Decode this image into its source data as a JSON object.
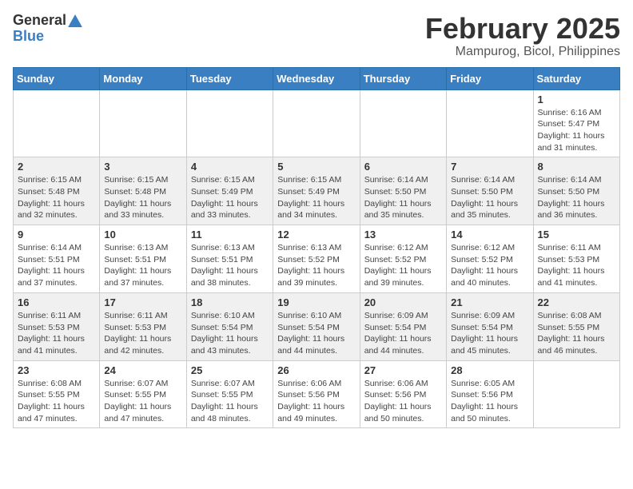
{
  "logo": {
    "general": "General",
    "blue": "Blue"
  },
  "title": {
    "month_year": "February 2025",
    "location": "Mampurog, Bicol, Philippines"
  },
  "weekdays": [
    "Sunday",
    "Monday",
    "Tuesday",
    "Wednesday",
    "Thursday",
    "Friday",
    "Saturday"
  ],
  "weeks": [
    [
      {
        "day": "",
        "info": ""
      },
      {
        "day": "",
        "info": ""
      },
      {
        "day": "",
        "info": ""
      },
      {
        "day": "",
        "info": ""
      },
      {
        "day": "",
        "info": ""
      },
      {
        "day": "",
        "info": ""
      },
      {
        "day": "1",
        "info": "Sunrise: 6:16 AM\nSunset: 5:47 PM\nDaylight: 11 hours and 31 minutes."
      }
    ],
    [
      {
        "day": "2",
        "info": "Sunrise: 6:15 AM\nSunset: 5:48 PM\nDaylight: 11 hours and 32 minutes."
      },
      {
        "day": "3",
        "info": "Sunrise: 6:15 AM\nSunset: 5:48 PM\nDaylight: 11 hours and 33 minutes."
      },
      {
        "day": "4",
        "info": "Sunrise: 6:15 AM\nSunset: 5:49 PM\nDaylight: 11 hours and 33 minutes."
      },
      {
        "day": "5",
        "info": "Sunrise: 6:15 AM\nSunset: 5:49 PM\nDaylight: 11 hours and 34 minutes."
      },
      {
        "day": "6",
        "info": "Sunrise: 6:14 AM\nSunset: 5:50 PM\nDaylight: 11 hours and 35 minutes."
      },
      {
        "day": "7",
        "info": "Sunrise: 6:14 AM\nSunset: 5:50 PM\nDaylight: 11 hours and 35 minutes."
      },
      {
        "day": "8",
        "info": "Sunrise: 6:14 AM\nSunset: 5:50 PM\nDaylight: 11 hours and 36 minutes."
      }
    ],
    [
      {
        "day": "9",
        "info": "Sunrise: 6:14 AM\nSunset: 5:51 PM\nDaylight: 11 hours and 37 minutes."
      },
      {
        "day": "10",
        "info": "Sunrise: 6:13 AM\nSunset: 5:51 PM\nDaylight: 11 hours and 37 minutes."
      },
      {
        "day": "11",
        "info": "Sunrise: 6:13 AM\nSunset: 5:51 PM\nDaylight: 11 hours and 38 minutes."
      },
      {
        "day": "12",
        "info": "Sunrise: 6:13 AM\nSunset: 5:52 PM\nDaylight: 11 hours and 39 minutes."
      },
      {
        "day": "13",
        "info": "Sunrise: 6:12 AM\nSunset: 5:52 PM\nDaylight: 11 hours and 39 minutes."
      },
      {
        "day": "14",
        "info": "Sunrise: 6:12 AM\nSunset: 5:52 PM\nDaylight: 11 hours and 40 minutes."
      },
      {
        "day": "15",
        "info": "Sunrise: 6:11 AM\nSunset: 5:53 PM\nDaylight: 11 hours and 41 minutes."
      }
    ],
    [
      {
        "day": "16",
        "info": "Sunrise: 6:11 AM\nSunset: 5:53 PM\nDaylight: 11 hours and 41 minutes."
      },
      {
        "day": "17",
        "info": "Sunrise: 6:11 AM\nSunset: 5:53 PM\nDaylight: 11 hours and 42 minutes."
      },
      {
        "day": "18",
        "info": "Sunrise: 6:10 AM\nSunset: 5:54 PM\nDaylight: 11 hours and 43 minutes."
      },
      {
        "day": "19",
        "info": "Sunrise: 6:10 AM\nSunset: 5:54 PM\nDaylight: 11 hours and 44 minutes."
      },
      {
        "day": "20",
        "info": "Sunrise: 6:09 AM\nSunset: 5:54 PM\nDaylight: 11 hours and 44 minutes."
      },
      {
        "day": "21",
        "info": "Sunrise: 6:09 AM\nSunset: 5:54 PM\nDaylight: 11 hours and 45 minutes."
      },
      {
        "day": "22",
        "info": "Sunrise: 6:08 AM\nSunset: 5:55 PM\nDaylight: 11 hours and 46 minutes."
      }
    ],
    [
      {
        "day": "23",
        "info": "Sunrise: 6:08 AM\nSunset: 5:55 PM\nDaylight: 11 hours and 47 minutes."
      },
      {
        "day": "24",
        "info": "Sunrise: 6:07 AM\nSunset: 5:55 PM\nDaylight: 11 hours and 47 minutes."
      },
      {
        "day": "25",
        "info": "Sunrise: 6:07 AM\nSunset: 5:55 PM\nDaylight: 11 hours and 48 minutes."
      },
      {
        "day": "26",
        "info": "Sunrise: 6:06 AM\nSunset: 5:56 PM\nDaylight: 11 hours and 49 minutes."
      },
      {
        "day": "27",
        "info": "Sunrise: 6:06 AM\nSunset: 5:56 PM\nDaylight: 11 hours and 50 minutes."
      },
      {
        "day": "28",
        "info": "Sunrise: 6:05 AM\nSunset: 5:56 PM\nDaylight: 11 hours and 50 minutes."
      },
      {
        "day": "",
        "info": ""
      }
    ]
  ]
}
